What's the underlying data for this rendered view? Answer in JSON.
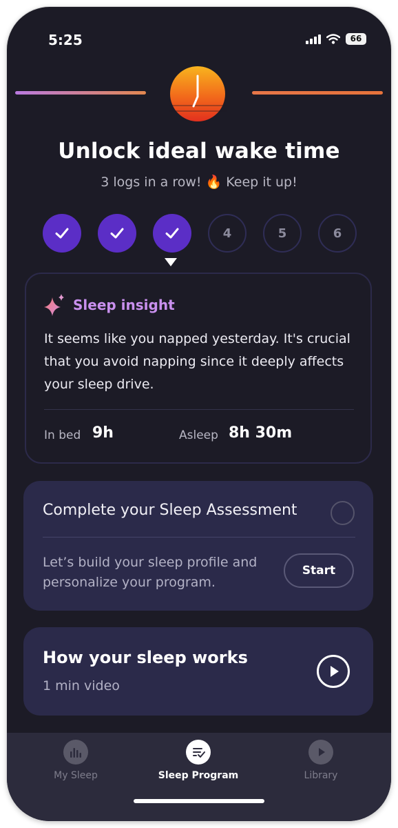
{
  "status_bar": {
    "time": "5:25",
    "battery": "66"
  },
  "header": {
    "title": "Unlock ideal wake time",
    "subtitle": "3 logs in a row! 🔥 Keep it up!"
  },
  "steps": [
    {
      "state": "done",
      "label": ""
    },
    {
      "state": "done",
      "label": ""
    },
    {
      "state": "done",
      "label": ""
    },
    {
      "state": "todo",
      "label": "4"
    },
    {
      "state": "todo",
      "label": "5"
    },
    {
      "state": "todo",
      "label": "6"
    }
  ],
  "insight": {
    "title": "Sleep insight",
    "body": "It seems like you napped yesterday. It's crucial that you avoid napping since it deeply affects your sleep drive.",
    "in_bed_label": "In bed",
    "in_bed_value": "9h",
    "asleep_label": "Asleep",
    "asleep_value": "8h 30m"
  },
  "assessment": {
    "title": "Complete your Sleep Assessment",
    "description": "Let’s build your sleep profile and personalize your program.",
    "start_label": "Start"
  },
  "video": {
    "title": "How your sleep works",
    "subtitle": "1 min video"
  },
  "tabs": [
    {
      "label": "My Sleep",
      "active": false,
      "icon": "bar-chart-icon"
    },
    {
      "label": "Sleep Program",
      "active": true,
      "icon": "checklist-icon"
    },
    {
      "label": "Library",
      "active": false,
      "icon": "play-icon"
    }
  ],
  "colors": {
    "background": "#1c1b26",
    "accent_purple": "#5b2ec6",
    "card": "#2b2a4a",
    "insight_title": "#c990ee"
  }
}
